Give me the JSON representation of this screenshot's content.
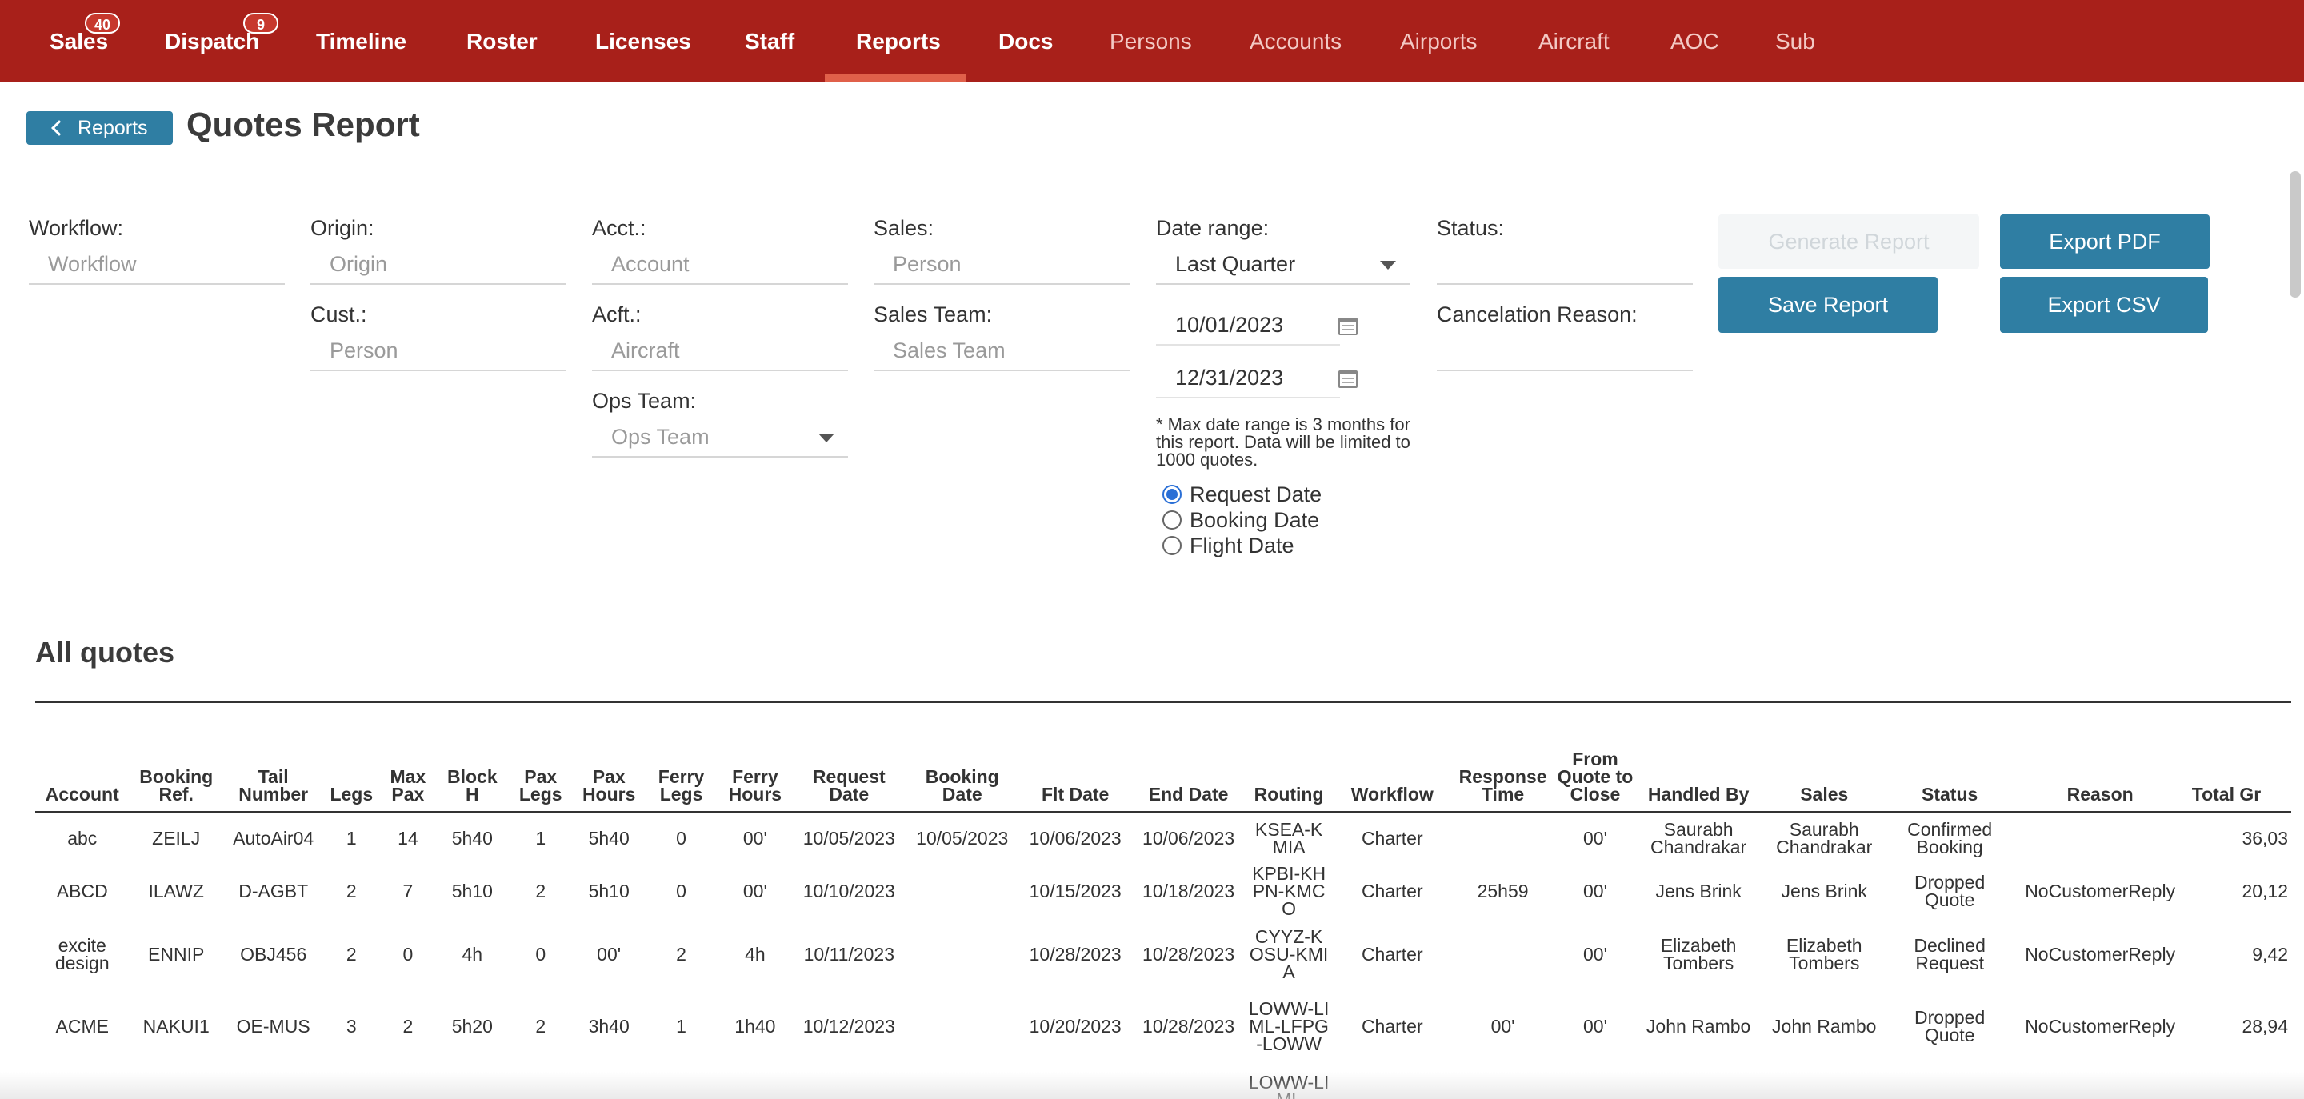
{
  "nav": {
    "items": [
      {
        "label": "Sales",
        "badge": "40"
      },
      {
        "label": "Dispatch",
        "badge": "9"
      },
      {
        "label": "Timeline"
      },
      {
        "label": "Roster"
      },
      {
        "label": "Licenses"
      },
      {
        "label": "Staff"
      },
      {
        "label": "Reports",
        "active": true
      },
      {
        "label": "Docs"
      },
      {
        "label": "Persons"
      },
      {
        "label": "Accounts"
      },
      {
        "label": "Airports"
      },
      {
        "label": "Aircraft"
      },
      {
        "label": "AOC"
      },
      {
        "label": "Sub"
      }
    ]
  },
  "header": {
    "back_label": "Reports",
    "title": "Quotes Report"
  },
  "filters": {
    "workflow": {
      "label": "Workflow:",
      "placeholder": "Workflow"
    },
    "origin": {
      "label": "Origin:",
      "placeholder": "Origin"
    },
    "cust": {
      "label": "Cust.:",
      "placeholder": "Person"
    },
    "acct": {
      "label": "Acct.:",
      "placeholder": "Account"
    },
    "acft": {
      "label": "Acft.:",
      "placeholder": "Aircraft"
    },
    "ops_team": {
      "label": "Ops Team:",
      "placeholder": "Ops Team"
    },
    "sales": {
      "label": "Sales:",
      "placeholder": "Person"
    },
    "sales_team": {
      "label": "Sales Team:",
      "placeholder": "Sales Team"
    },
    "date_range": {
      "label": "Date range:",
      "value": "Last Quarter",
      "start": "10/01/2023",
      "end": "12/31/2023"
    },
    "note": "* Max date range is 3 months for this report. Data will be limited to 1000 quotes.",
    "date_type": {
      "options": [
        "Request Date",
        "Booking Date",
        "Flight Date"
      ],
      "selected": "Request Date"
    },
    "status": {
      "label": "Status:"
    },
    "cancel_reason": {
      "label": "Cancelation Reason:"
    }
  },
  "buttons": {
    "generate": "Generate Report",
    "save": "Save Report",
    "export_pdf": "Export PDF",
    "export_csv": "Export CSV"
  },
  "table": {
    "title": "All quotes",
    "columns": [
      "Account",
      "Booking Ref.",
      "Tail Number",
      "Legs",
      "Max Pax",
      "Block H",
      "Pax Legs",
      "Pax Hours",
      "Ferry Legs",
      "Ferry Hours",
      "Request Date",
      "Booking Date",
      "Flt Date",
      "End Date",
      "Routing",
      "Workflow",
      "Response Time",
      "From Quote to Close",
      "Handled By",
      "Sales",
      "Status",
      "Reason",
      "Total Gr"
    ],
    "rows": [
      [
        "abc",
        "ZEILJ",
        "AutoAir04",
        "1",
        "14",
        "5h40",
        "1",
        "5h40",
        "0",
        "00'",
        "10/05/2023",
        "10/05/2023",
        "10/06/2023",
        "10/06/2023",
        "KSEA-KMIA",
        "Charter",
        "",
        "00'",
        "Saurabh Chandrakar",
        "Saurabh Chandrakar",
        "Confirmed Booking",
        "",
        "36,03"
      ],
      [
        "ABCD",
        "ILAWZ",
        "D-AGBT",
        "2",
        "7",
        "5h10",
        "2",
        "5h10",
        "0",
        "00'",
        "10/10/2023",
        "",
        "10/15/2023",
        "10/18/2023",
        "KPBI-KHPN-KMCO",
        "Charter",
        "25h59",
        "00'",
        "Jens Brink",
        "Jens Brink",
        "Dropped Quote",
        "NoCustomerReply",
        "20,12"
      ],
      [
        "excite design",
        "ENNIP",
        "OBJ456",
        "2",
        "0",
        "4h",
        "0",
        "00'",
        "2",
        "4h",
        "10/11/2023",
        "",
        "10/28/2023",
        "10/28/2023",
        "CYYZ-KOSU-KMIA",
        "Charter",
        "",
        "00'",
        "Elizabeth Tombers",
        "Elizabeth Tombers",
        "Declined Request",
        "NoCustomerReply",
        "9,42"
      ],
      [
        "ACME",
        "NAKUI1",
        "OE-MUS",
        "3",
        "2",
        "5h20",
        "2",
        "3h40",
        "1",
        "1h40",
        "10/12/2023",
        "",
        "10/20/2023",
        "10/28/2023",
        "LOWW-LIML-LFPG-LOWW",
        "Charter",
        "00'",
        "00'",
        "John Rambo",
        "John Rambo",
        "Dropped Quote",
        "NoCustomerReply",
        "28,94"
      ],
      [
        "",
        "",
        "",
        "",
        "",
        "",
        "",
        "",
        "",
        "",
        "",
        "",
        "",
        "",
        "LOWW-LIML",
        "",
        "",
        "",
        "",
        "",
        "",
        "",
        ""
      ]
    ]
  },
  "colors": {
    "nav_bg": "#a8201a",
    "primary_button": "#2f7ea3",
    "badge": "#c7382d"
  }
}
